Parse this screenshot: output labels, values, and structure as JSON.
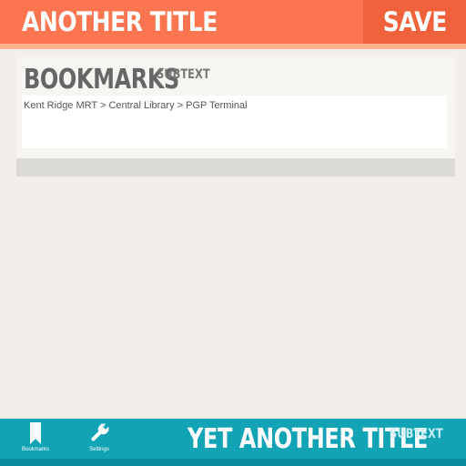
{
  "header": {
    "title": "ANOTHER TITLE",
    "save_label": "SAVE"
  },
  "card": {
    "title": "BOOKMARKS",
    "subtext": "SUBTEXT",
    "route": "Kent Ridge MRT >  Central Library > PGP Terminal"
  },
  "bottom_bar": {
    "nav": [
      {
        "label": "Bookmarks",
        "icon": "bookmark-icon"
      },
      {
        "label": "Settings",
        "icon": "wrench-icon"
      }
    ],
    "title": "YET ANOTHER TITLE",
    "subtext": "SUBTEXT"
  },
  "colors": {
    "header": "#fa7550",
    "save_button": "#f0623b",
    "bottom_bar": "#12a3b5",
    "background": "#f2efea"
  }
}
